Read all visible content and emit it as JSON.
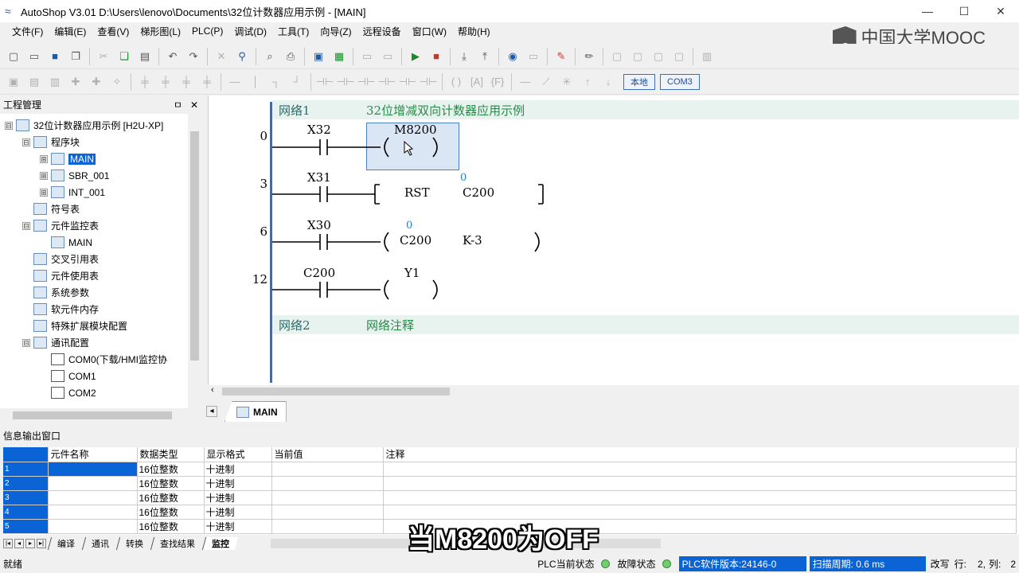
{
  "window": {
    "title": "AutoShop V3.01  D:\\Users\\lenovo\\Documents\\32位计数器应用示例 - [MAIN]",
    "controls": [
      "—",
      "☐",
      "✕"
    ]
  },
  "menu": [
    "文件(F)",
    "编辑(E)",
    "查看(V)",
    "梯形图(L)",
    "PLC(P)",
    "调试(D)",
    "工具(T)",
    "向导(Z)",
    "远程设备",
    "窗口(W)",
    "帮助(H)"
  ],
  "watermark": "中国大学MOOC",
  "toolbar2_buttons": {
    "local": "本地",
    "com": "COM3"
  },
  "project": {
    "title": "工程管理",
    "pin": "ㅁ",
    "close": "✕",
    "tree": [
      {
        "label": "32位计数器应用示例 [H2U-XP]",
        "level": 0,
        "exp": "⊟"
      },
      {
        "label": "程序块",
        "level": 1,
        "exp": "⊟"
      },
      {
        "label": "MAIN",
        "level": 2,
        "exp": "⊞",
        "selected": true
      },
      {
        "label": "SBR_001",
        "level": 2,
        "exp": "⊞"
      },
      {
        "label": "INT_001",
        "level": 2,
        "exp": "⊞"
      },
      {
        "label": "符号表",
        "level": 1,
        "exp": ""
      },
      {
        "label": "元件监控表",
        "level": 1,
        "exp": "⊟"
      },
      {
        "label": "MAIN",
        "level": 2,
        "exp": ""
      },
      {
        "label": "交叉引用表",
        "level": 1,
        "exp": ""
      },
      {
        "label": "元件使用表",
        "level": 1,
        "exp": ""
      },
      {
        "label": "系统参数",
        "level": 1,
        "exp": ""
      },
      {
        "label": "软元件内存",
        "level": 1,
        "exp": ""
      },
      {
        "label": "特殊扩展模块配置",
        "level": 1,
        "exp": ""
      },
      {
        "label": "通讯配置",
        "level": 1,
        "exp": "⊟"
      },
      {
        "label": "COM0(下载/HMI监控协",
        "level": 2,
        "exp": ""
      },
      {
        "label": "COM1",
        "level": 2,
        "exp": ""
      },
      {
        "label": "COM2",
        "level": 2,
        "exp": ""
      }
    ]
  },
  "ladder": {
    "network1": {
      "name": "网络1",
      "comment": "32位增减双向计数器应用示例"
    },
    "network2": {
      "name": "网络2",
      "comment": "网络注释"
    },
    "rungs": [
      {
        "step": "0",
        "contact": "X32",
        "coil": "M8200",
        "arg": ""
      },
      {
        "step": "3",
        "contact": "X31",
        "instr": "RST",
        "operand": "C200",
        "value": "0"
      },
      {
        "step": "6",
        "contact": "X30",
        "coil": "C200",
        "arg": "K-3",
        "value": "0"
      },
      {
        "step": "12",
        "contact": "C200",
        "coil": "Y1",
        "arg": ""
      }
    ]
  },
  "doc_tab": "MAIN",
  "info": {
    "title": "信息输出窗口",
    "columns": [
      "元件名称",
      "数据类型",
      "显示格式",
      "当前值",
      "注释"
    ],
    "rows": [
      {
        "n": "1",
        "type": "16位整数",
        "fmt": "十进制"
      },
      {
        "n": "2",
        "type": "16位整数",
        "fmt": "十进制"
      },
      {
        "n": "3",
        "type": "16位整数",
        "fmt": "十进制"
      },
      {
        "n": "4",
        "type": "16位整数",
        "fmt": "十进制"
      },
      {
        "n": "5",
        "type": "16位整数",
        "fmt": "十进制"
      }
    ],
    "tabs": [
      "编译",
      "通讯",
      "转换",
      "查找结果",
      "监控"
    ],
    "active_tab": "监控"
  },
  "subtitle": "当M8200为OFF",
  "status": {
    "ready": "就绪",
    "plc_state": "PLC当前状态",
    "fault_state": "故障状态",
    "version": "PLC软件版本:24146-0",
    "scan": "扫描周期: 0.6 ms",
    "mode": "改写",
    "row_label": "行:",
    "row": "2,",
    "col_label": "列:",
    "col": "2"
  }
}
